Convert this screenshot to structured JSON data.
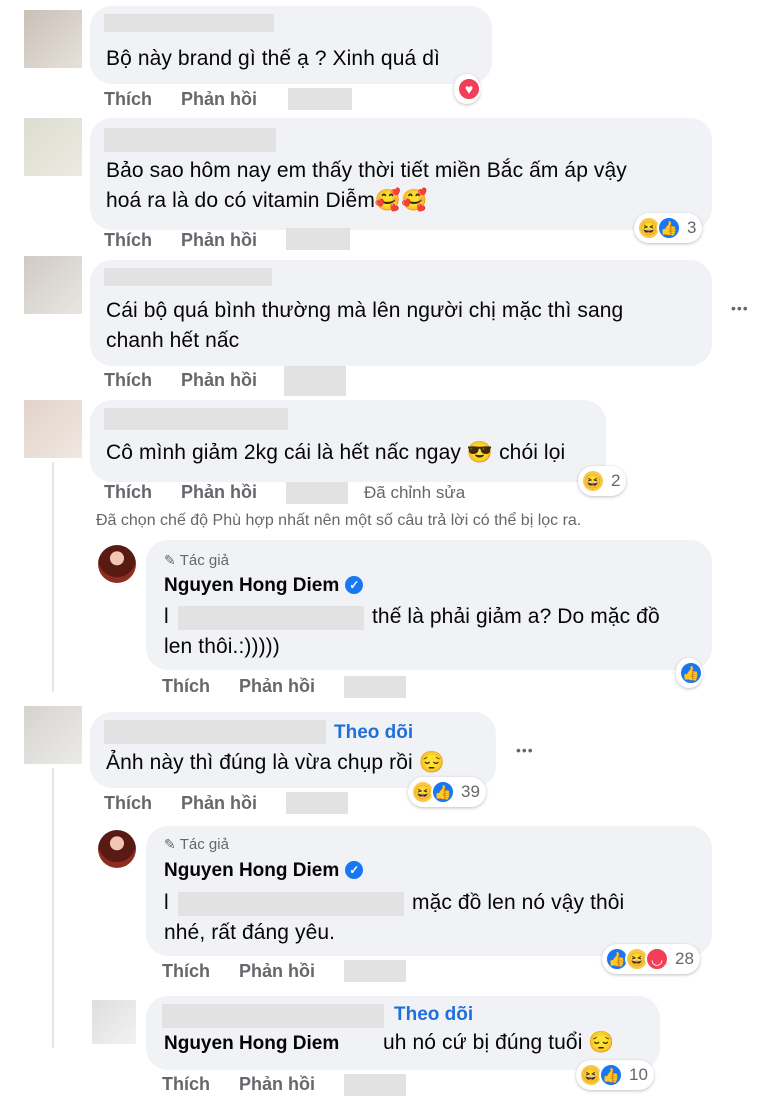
{
  "labels": {
    "like": "Thích",
    "reply": "Phản hồi",
    "edited": "Đã chỉnh sửa",
    "author_tag": "Tác giả",
    "follow": "Theo dõi",
    "filter_notice": "Đã chọn chế độ Phù hợp nhất nên một số câu trả lời có thể bị lọc ra.",
    "more": "•••"
  },
  "author": {
    "name": "Nguyen Hong Diem"
  },
  "comments": [
    {
      "text": "Bộ này brand gì thế ạ ? Xinh quá dì"
    },
    {
      "text_line1": "Bảo sao hôm nay em thấy thời tiết miền Bắc ấm áp vậy",
      "text_line2": "hoá ra là do có vitamin Diễm🥰🥰",
      "reactions": "3"
    },
    {
      "text_line1": "Cái bộ quá bình thường mà lên người chị mặc thì sang",
      "text_line2": "chanh hết nấc"
    },
    {
      "text": "Cô mình giảm 2kg cái là hết nấc ngay 😎 chói lọi",
      "reactions": "2"
    },
    {
      "text_line1_prefix": "l",
      "text_line1": "thế là phải giảm a? Do mặc đồ",
      "text_line2": "len thôi.:)))))"
    },
    {
      "text": "Ảnh này thì đúng là vừa chụp rồi 😔",
      "reactions": "39"
    },
    {
      "text_line1_prefix": "l",
      "text_line1": "mặc đồ len nó vậy thôi",
      "text_line2": "nhé, rất đáng yêu.",
      "reactions": "28"
    },
    {
      "text": "uh nó cứ bị đúng tuổi 😔",
      "reactions": "10"
    }
  ],
  "reaction_colors": {
    "like": "#1877f2",
    "love": "#f33e58",
    "haha": "#f7c94b"
  }
}
